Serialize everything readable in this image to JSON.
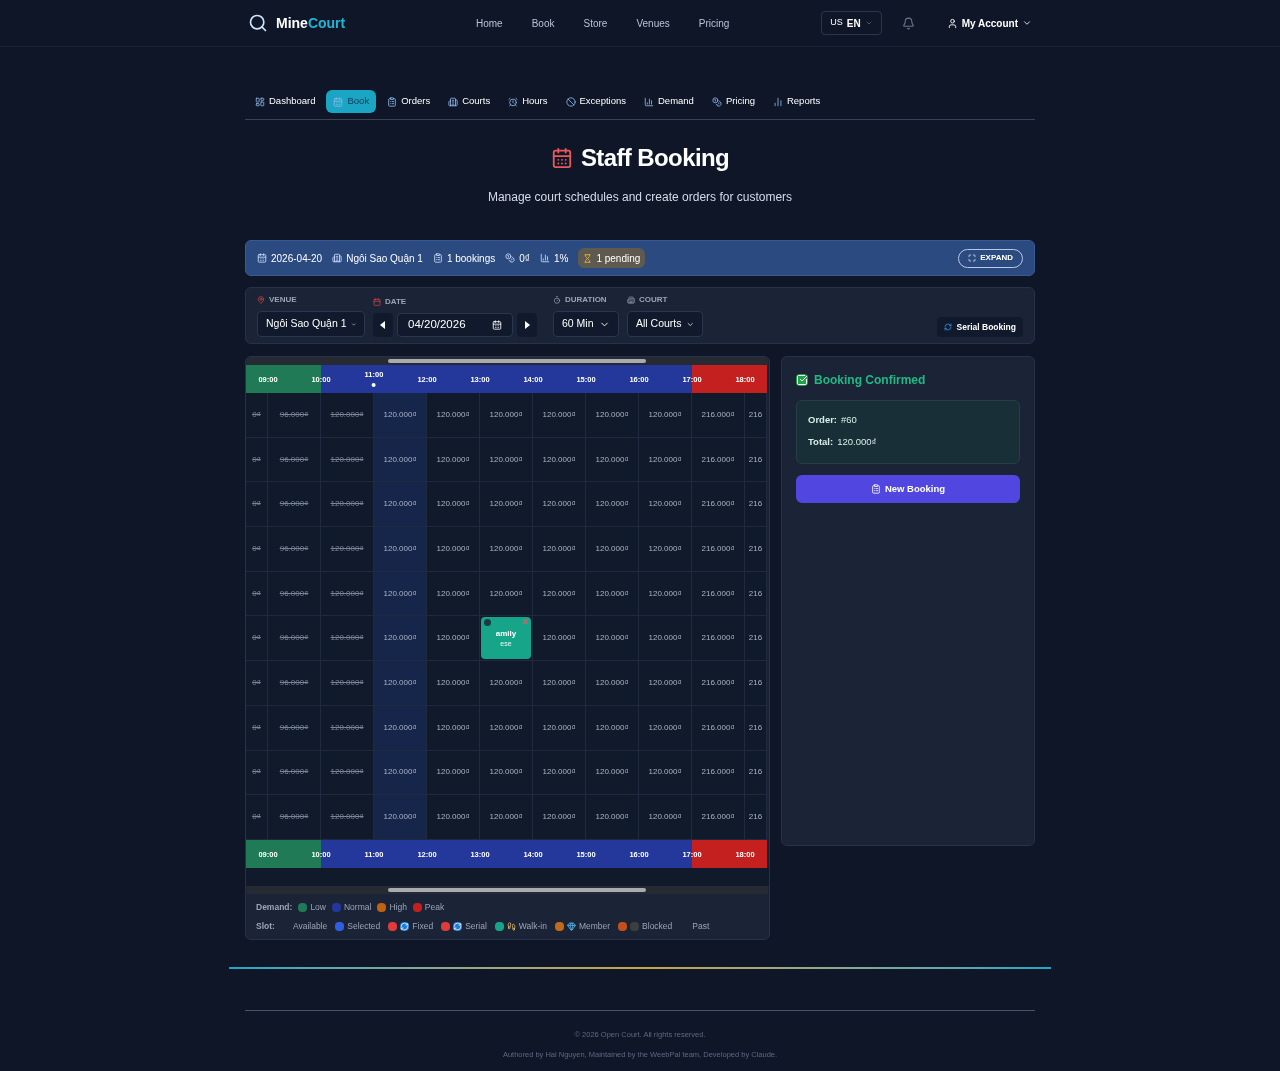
{
  "brand": {
    "first": "Mine",
    "second": "Court"
  },
  "nav": [
    "Home",
    "Book",
    "Store",
    "Venues",
    "Pricing"
  ],
  "language": {
    "flag": "US",
    "code": "EN"
  },
  "account": "My Account",
  "tabs": [
    {
      "label": "Dashboard",
      "selected": false
    },
    {
      "label": "Book",
      "selected": true
    },
    {
      "label": "Orders",
      "selected": false
    },
    {
      "label": "Courts",
      "selected": false
    },
    {
      "label": "Hours",
      "selected": false
    },
    {
      "label": "Exceptions",
      "selected": false
    },
    {
      "label": "Demand",
      "selected": false
    },
    {
      "label": "Pricing",
      "selected": false
    },
    {
      "label": "Reports",
      "selected": false
    }
  ],
  "title": "Staff Booking",
  "subtitle": "Manage court schedules and create orders for customers",
  "summary": {
    "items": [
      "2026-04-20",
      "Ngôi Sao Quận 1",
      "1 bookings",
      "0₫",
      "1%"
    ],
    "pending": "1 pending",
    "expand": "EXPAND"
  },
  "filters": {
    "venue": {
      "label": "VENUE",
      "value": "Ngôi Sao Quận 1"
    },
    "date": {
      "label": "DATE",
      "value": "04/20/2026"
    },
    "duration": {
      "label": "DURATION",
      "value": "60 Min"
    },
    "court": {
      "label": "COURT",
      "value": "All Courts"
    },
    "serial": "Serial Booking"
  },
  "schedule": {
    "columns": [
      {
        "color": "#1f7a55",
        "current": false
      },
      {
        "hour": "09:00",
        "color": "#1f7a55",
        "current": false
      },
      {
        "hour": "10:00",
        "color": "#23389a",
        "current": false
      },
      {
        "hour": "11:00",
        "color": "#23389a",
        "current": true
      },
      {
        "hour": "12:00",
        "color": "#23389a",
        "current": false
      },
      {
        "hour": "13:00",
        "color": "#23389a",
        "current": false
      },
      {
        "hour": "14:00",
        "color": "#23389a",
        "current": false
      },
      {
        "hour": "15:00",
        "color": "#23389a",
        "current": false
      },
      {
        "hour": "16:00",
        "color": "#23389a",
        "current": false
      },
      {
        "hour": "17:00",
        "color": "#c42020",
        "current": false
      },
      {
        "hour": "18:00",
        "color": "#c42020",
        "current": false
      }
    ],
    "footer": [
      "09:00",
      "10:00",
      "11:00",
      "12:00",
      "13:00",
      "14:00",
      "15:00",
      "16:00",
      "17:00",
      "18:00"
    ],
    "rows": [
      [
        {
          "kind": "past",
          "text": "0₫"
        },
        {
          "kind": "past",
          "text": "96.000₫"
        },
        {
          "kind": "past",
          "text": "120.000₫"
        },
        {
          "kind": "available",
          "text": "120.000₫"
        },
        {
          "kind": "available",
          "text": "120.000₫"
        },
        {
          "kind": "available",
          "text": "120.000₫"
        },
        {
          "kind": "available",
          "text": "120.000₫"
        },
        {
          "kind": "available",
          "text": "120.000₫"
        },
        {
          "kind": "available",
          "text": "120.000₫"
        },
        {
          "kind": "available",
          "text": "216.000₫"
        },
        {
          "kind": "available",
          "text": "216"
        }
      ],
      [
        {
          "kind": "past",
          "text": "0₫"
        },
        {
          "kind": "past",
          "text": "96.000₫"
        },
        {
          "kind": "past",
          "text": "120.000₫"
        },
        {
          "kind": "available",
          "text": "120.000₫"
        },
        {
          "kind": "available",
          "text": "120.000₫"
        },
        {
          "kind": "available",
          "text": "120.000₫"
        },
        {
          "kind": "available",
          "text": "120.000₫"
        },
        {
          "kind": "available",
          "text": "120.000₫"
        },
        {
          "kind": "available",
          "text": "120.000₫"
        },
        {
          "kind": "available",
          "text": "216.000₫"
        },
        {
          "kind": "available",
          "text": "216"
        }
      ],
      [
        {
          "kind": "past",
          "text": "0₫"
        },
        {
          "kind": "past",
          "text": "96.000₫"
        },
        {
          "kind": "past",
          "text": "120.000₫"
        },
        {
          "kind": "available",
          "text": "120.000₫"
        },
        {
          "kind": "available",
          "text": "120.000₫"
        },
        {
          "kind": "available",
          "text": "120.000₫"
        },
        {
          "kind": "available",
          "text": "120.000₫"
        },
        {
          "kind": "available",
          "text": "120.000₫"
        },
        {
          "kind": "available",
          "text": "120.000₫"
        },
        {
          "kind": "available",
          "text": "216.000₫"
        },
        {
          "kind": "available",
          "text": "216"
        }
      ],
      [
        {
          "kind": "past",
          "text": "0₫"
        },
        {
          "kind": "past",
          "text": "96.000₫"
        },
        {
          "kind": "past",
          "text": "120.000₫"
        },
        {
          "kind": "available",
          "text": "120.000₫"
        },
        {
          "kind": "available",
          "text": "120.000₫"
        },
        {
          "kind": "available",
          "text": "120.000₫"
        },
        {
          "kind": "available",
          "text": "120.000₫"
        },
        {
          "kind": "available",
          "text": "120.000₫"
        },
        {
          "kind": "available",
          "text": "120.000₫"
        },
        {
          "kind": "available",
          "text": "216.000₫"
        },
        {
          "kind": "available",
          "text": "216"
        }
      ],
      [
        {
          "kind": "past",
          "text": "0₫"
        },
        {
          "kind": "past",
          "text": "96.000₫"
        },
        {
          "kind": "past",
          "text": "120.000₫"
        },
        {
          "kind": "available",
          "text": "120.000₫"
        },
        {
          "kind": "available",
          "text": "120.000₫"
        },
        {
          "kind": "available",
          "text": "120.000₫"
        },
        {
          "kind": "available",
          "text": "120.000₫"
        },
        {
          "kind": "available",
          "text": "120.000₫"
        },
        {
          "kind": "available",
          "text": "120.000₫"
        },
        {
          "kind": "available",
          "text": "216.000₫"
        },
        {
          "kind": "available",
          "text": "216"
        }
      ],
      [
        {
          "kind": "past",
          "text": "0₫"
        },
        {
          "kind": "past",
          "text": "96.000₫"
        },
        {
          "kind": "past",
          "text": "120.000₫"
        },
        {
          "kind": "available",
          "text": "120.000₫"
        },
        {
          "kind": "available",
          "text": "120.000₫"
        },
        {
          "kind": "booked",
          "text": "amily",
          "code": "ese"
        },
        {
          "kind": "available",
          "text": "120.000₫"
        },
        {
          "kind": "available",
          "text": "120.000₫"
        },
        {
          "kind": "available",
          "text": "120.000₫"
        },
        {
          "kind": "available",
          "text": "216.000₫"
        },
        {
          "kind": "available",
          "text": "216"
        }
      ],
      [
        {
          "kind": "past",
          "text": "0₫"
        },
        {
          "kind": "past",
          "text": "96.000₫"
        },
        {
          "kind": "past",
          "text": "120.000₫"
        },
        {
          "kind": "available",
          "text": "120.000₫"
        },
        {
          "kind": "available",
          "text": "120.000₫"
        },
        {
          "kind": "available",
          "text": "120.000₫"
        },
        {
          "kind": "available",
          "text": "120.000₫"
        },
        {
          "kind": "available",
          "text": "120.000₫"
        },
        {
          "kind": "available",
          "text": "120.000₫"
        },
        {
          "kind": "available",
          "text": "216.000₫"
        },
        {
          "kind": "available",
          "text": "216"
        }
      ],
      [
        {
          "kind": "past",
          "text": "0₫"
        },
        {
          "kind": "past",
          "text": "96.000₫"
        },
        {
          "kind": "past",
          "text": "120.000₫"
        },
        {
          "kind": "available",
          "text": "120.000₫"
        },
        {
          "kind": "available",
          "text": "120.000₫"
        },
        {
          "kind": "available",
          "text": "120.000₫"
        },
        {
          "kind": "available",
          "text": "120.000₫"
        },
        {
          "kind": "available",
          "text": "120.000₫"
        },
        {
          "kind": "available",
          "text": "120.000₫"
        },
        {
          "kind": "available",
          "text": "216.000₫"
        },
        {
          "kind": "available",
          "text": "216"
        }
      ],
      [
        {
          "kind": "past",
          "text": "0₫"
        },
        {
          "kind": "past",
          "text": "96.000₫"
        },
        {
          "kind": "past",
          "text": "120.000₫"
        },
        {
          "kind": "available",
          "text": "120.000₫"
        },
        {
          "kind": "available",
          "text": "120.000₫"
        },
        {
          "kind": "available",
          "text": "120.000₫"
        },
        {
          "kind": "available",
          "text": "120.000₫"
        },
        {
          "kind": "available",
          "text": "120.000₫"
        },
        {
          "kind": "available",
          "text": "120.000₫"
        },
        {
          "kind": "available",
          "text": "216.000₫"
        },
        {
          "kind": "available",
          "text": "216"
        }
      ],
      [
        {
          "kind": "past",
          "text": "0₫"
        },
        {
          "kind": "past",
          "text": "96.000₫"
        },
        {
          "kind": "past",
          "text": "120.000₫"
        },
        {
          "kind": "available",
          "text": "120.000₫"
        },
        {
          "kind": "available",
          "text": "120.000₫"
        },
        {
          "kind": "available",
          "text": "120.000₫"
        },
        {
          "kind": "available",
          "text": "120.000₫"
        },
        {
          "kind": "available",
          "text": "120.000₫"
        },
        {
          "kind": "available",
          "text": "120.000₫"
        },
        {
          "kind": "available",
          "text": "216.000₫"
        },
        {
          "kind": "available",
          "text": "216"
        }
      ]
    ]
  },
  "legend": {
    "demand_label": "Demand:",
    "demand": [
      {
        "label": "Low",
        "color": "#1f7a55"
      },
      {
        "label": "Normal",
        "color": "#23389a"
      },
      {
        "label": "High",
        "color": "#c2610f"
      },
      {
        "label": "Peak",
        "color": "#c42020"
      }
    ],
    "slot_label": "Slot:",
    "slots": [
      {
        "label": "Available",
        "kind": "plain"
      },
      {
        "label": "Selected",
        "kind": "swatch",
        "color": "#2f5fe0"
      },
      {
        "label": "Fixed",
        "kind": "repeat",
        "color": "#e03a3a"
      },
      {
        "label": "Serial",
        "kind": "repeat",
        "color": "#e03a3a"
      },
      {
        "label": "Walk-in",
        "kind": "walker",
        "color": "#17a58a"
      },
      {
        "label": "Member",
        "kind": "gem",
        "color": "#c26a1a"
      },
      {
        "label": "Blocked",
        "kind": "block",
        "color": "#c2501a"
      },
      {
        "label": "Past",
        "kind": "plain"
      }
    ]
  },
  "confirmation": {
    "title": "Booking Confirmed",
    "order_label": "Order:",
    "order": "#60",
    "total_label": "Total:",
    "total": "120.000₫",
    "button": "New Booking"
  },
  "footer": {
    "copyright": "© 2026 Open Court. All rights reserved.",
    "credits": "Authored by Hai Nguyen, Maintained by the WeebPal team, Developed by Claude."
  }
}
